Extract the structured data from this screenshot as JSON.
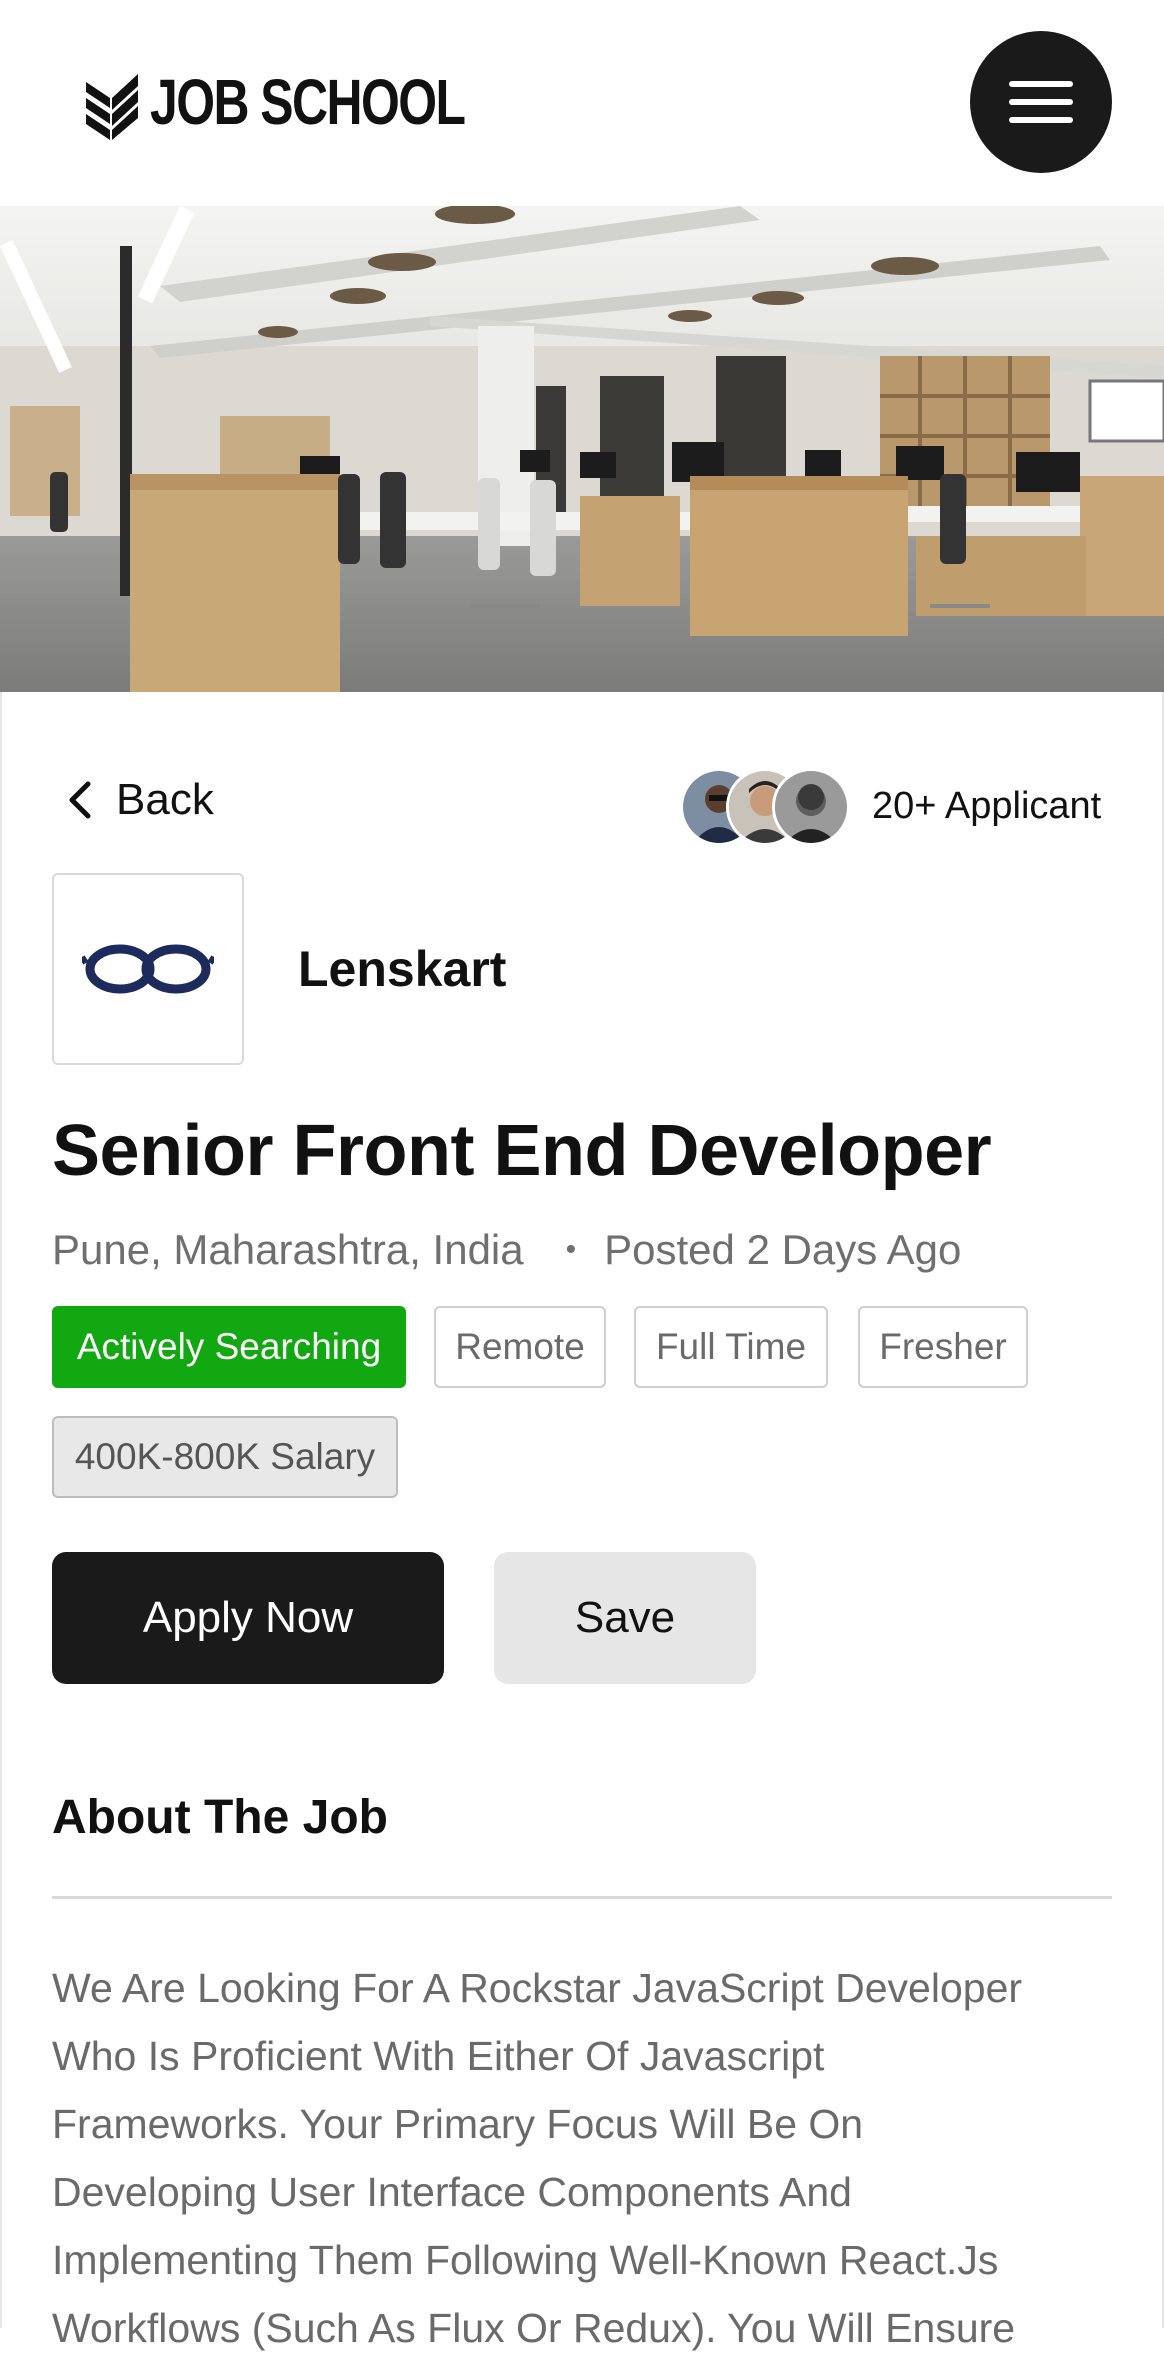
{
  "header": {
    "logo_text": "JOB SCHOOL",
    "menu_icon": "hamburger-menu-icon"
  },
  "hero": {
    "image_alt": "Open plan office interior"
  },
  "nav": {
    "back_label": "Back",
    "back_icon": "chevron-left-icon"
  },
  "applicants": {
    "count_label": "20+ Applicant"
  },
  "company": {
    "name": "Lenskart",
    "logo_icon": "glasses-logo-icon",
    "brand_color": "#1d2a5c"
  },
  "job": {
    "title": "Senior Front End Developer",
    "location": "Pune, Maharashtra, India",
    "separator": "•",
    "posted": "Posted 2 Days Ago",
    "tags": [
      {
        "label": "Actively Searching",
        "style": "active"
      },
      {
        "label": "Remote",
        "style": "plain"
      },
      {
        "label": "Full Time",
        "style": "plain"
      },
      {
        "label": "Fresher",
        "style": "plain"
      },
      {
        "label": "400K-800K Salary",
        "style": "salary"
      }
    ]
  },
  "actions": {
    "apply_label": "Apply Now",
    "save_label": "Save"
  },
  "about": {
    "heading": "About The Job",
    "lines": [
      "We Are Looking For A Rockstar JavaScript Developer",
      "Who Is Proficient With Either Of Javascript",
      "Frameworks. Your Primary Focus Will Be On",
      "Developing User Interface Components And",
      "Implementing Them Following Well-Known React.Js",
      "Workflows (Such As Flux Or Redux). You Will Ensure"
    ]
  },
  "colors": {
    "accent_dark": "#1a1a1a",
    "active_tag": "#12a812",
    "muted_text": "#6a6a6a"
  }
}
